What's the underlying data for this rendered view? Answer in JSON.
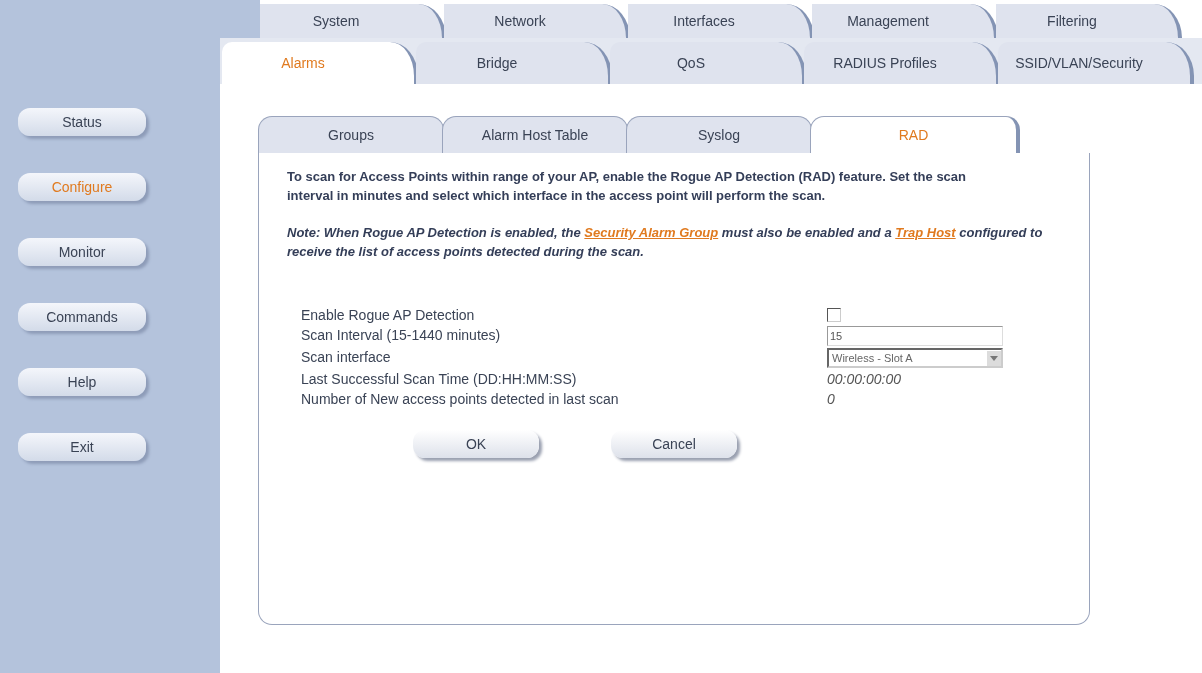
{
  "top_tabs": [
    {
      "label": "System",
      "selected": false
    },
    {
      "label": "Network",
      "selected": false
    },
    {
      "label": "Interfaces",
      "selected": false
    },
    {
      "label": "Management",
      "selected": false
    },
    {
      "label": "Filtering",
      "selected": false
    }
  ],
  "sub_tabs": [
    {
      "label": "Alarms",
      "selected": true
    },
    {
      "label": "Bridge",
      "selected": false
    },
    {
      "label": "QoS",
      "selected": false
    },
    {
      "label": "RADIUS Profiles",
      "selected": false
    },
    {
      "label": "SSID/VLAN/Security",
      "selected": false
    }
  ],
  "sidebar": {
    "items": [
      {
        "label": "Status",
        "selected": false
      },
      {
        "label": "Configure",
        "selected": true
      },
      {
        "label": "Monitor",
        "selected": false
      },
      {
        "label": "Commands",
        "selected": false
      },
      {
        "label": "Help",
        "selected": false
      },
      {
        "label": "Exit",
        "selected": false
      }
    ]
  },
  "inner_tabs": [
    {
      "label": "Groups",
      "selected": false
    },
    {
      "label": "Alarm Host Table",
      "selected": false
    },
    {
      "label": "Syslog",
      "selected": false
    },
    {
      "label": "RAD",
      "selected": true
    }
  ],
  "intro": "To scan for Access Points within range of your AP, enable the Rogue AP Detection (RAD) feature. Set the scan interval in minutes and select which interface in the access point will perform the scan.",
  "note": [
    {
      "kind": "text",
      "text": "Note: When Rogue AP Detection is enabled, the "
    },
    {
      "kind": "link",
      "text": "Security Alarm Group"
    },
    {
      "kind": "text",
      "text": " must also be enabled and a "
    },
    {
      "kind": "link",
      "text": "Trap Host"
    },
    {
      "kind": "text",
      "text": " configured to receive the list of access points detected during the scan."
    }
  ],
  "fields": [
    {
      "kind": "checkbox",
      "label": "Enable Rogue AP Detection",
      "checked": false
    },
    {
      "kind": "text",
      "label": "Scan Interval (15-1440 minutes)",
      "value": "15"
    },
    {
      "kind": "select",
      "label": "Scan interface",
      "value": "Wireless - Slot A"
    },
    {
      "kind": "value",
      "label": "Last Successful Scan Time (DD:HH:MM:SS)",
      "value": "00:00:00:00"
    },
    {
      "kind": "value",
      "label": "Number of New access points detected in last scan",
      "value": "0"
    }
  ],
  "buttons": [
    "OK",
    "Cancel"
  ]
}
